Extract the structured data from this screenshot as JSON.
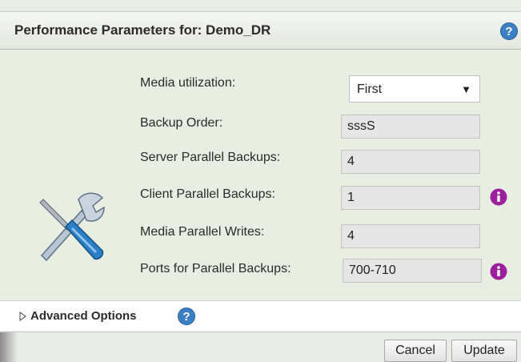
{
  "dialog": {
    "title": "Performance Parameters for: Demo_DR",
    "help_icon": "help-circle-icon",
    "tools_icon": "screwdriver-wrench-icon"
  },
  "fields": {
    "media_utilization": {
      "label": "Media utilization:",
      "value": "First",
      "arrow": "▼"
    },
    "backup_order": {
      "label": "Backup Order:",
      "value": "sssS"
    },
    "server_parallel_backups": {
      "label": "Server Parallel Backups:",
      "value": "4"
    },
    "client_parallel_backups": {
      "label": "Client Parallel Backups:",
      "value": "1",
      "icon": "info-icon"
    },
    "media_parallel_writes": {
      "label": "Media Parallel Writes:",
      "value": "4"
    },
    "ports_parallel_backups": {
      "label": "Ports for Parallel Backups:",
      "value": "700-710",
      "icon": "info-icon"
    }
  },
  "advanced": {
    "label": "Advanced Options",
    "expanded": false
  },
  "footer": {
    "cancel_label": "Cancel",
    "update_label": "Update"
  },
  "colors": {
    "help_blue": "#3b7fc4",
    "info_purple": "#9c1f9c",
    "panel_bg": "#e9eee3"
  }
}
